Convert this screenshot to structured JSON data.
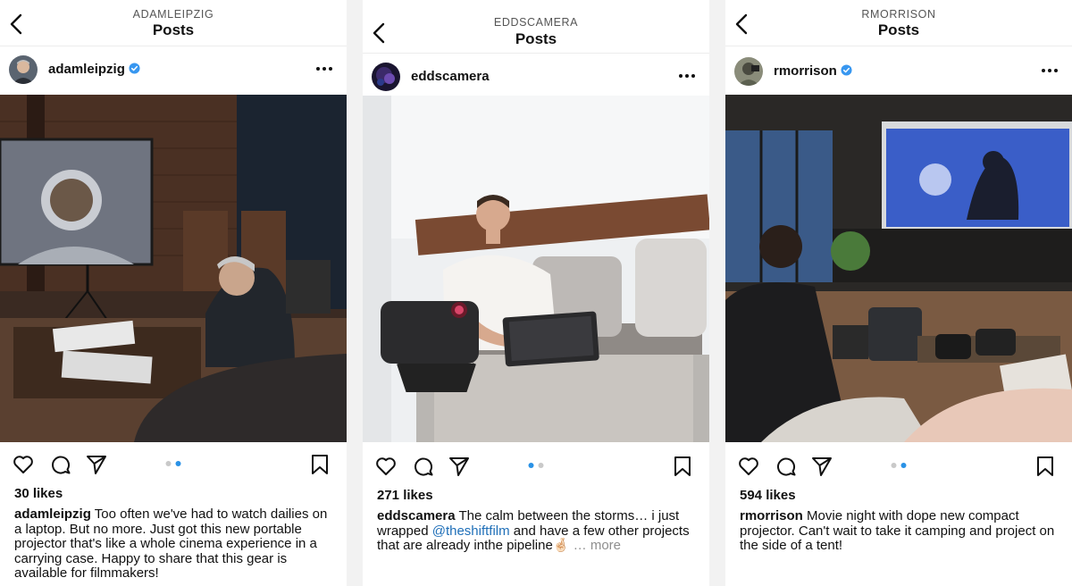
{
  "posts": [
    {
      "account_label": "ADAMLEIPZIG",
      "screen_title": "Posts",
      "username": "adamleipzig",
      "verified": true,
      "likes": "30 likes",
      "caption_user": "adamleipzig",
      "caption_text": "Too often we've had to watch dailies on a laptop. But no more. Just got this new portable projector that's like a whole cinema experience in a carrying case. Happy to share that this gear is available for filmmakers!",
      "carousel": {
        "count": 2,
        "active": 2
      },
      "icons": [
        "back-icon",
        "verified-icon",
        "more-options-icon",
        "heart-icon",
        "comment-icon",
        "share-icon",
        "bookmark-icon"
      ]
    },
    {
      "account_label": "EDDSCAMERA",
      "screen_title": "Posts",
      "username": "eddscamera",
      "verified": false,
      "likes": "271 likes",
      "caption_user": "eddscamera",
      "caption_text_1": "The calm between the storms…  i just wrapped ",
      "mention": "@theshiftfilm",
      "caption_text_2": " and have a few other projects that are already inthe pipeline",
      "emoji": "🤞🏻",
      "more_label": "… more",
      "carousel": {
        "count": 2,
        "active": 1
      },
      "icons": [
        "back-icon",
        "more-options-icon",
        "heart-icon",
        "comment-icon",
        "share-icon",
        "bookmark-icon"
      ]
    },
    {
      "account_label": "RMORRISON",
      "screen_title": "Posts",
      "username": "rmorrison",
      "verified": true,
      "likes": "594 likes",
      "caption_user": "rmorrison",
      "caption_text": "Movie night with dope new compact projector.  Can't wait to take it camping and project on the side of a tent!",
      "carousel": {
        "count": 2,
        "active": 2
      },
      "icons": [
        "back-icon",
        "verified-icon",
        "more-options-icon",
        "heart-icon",
        "comment-icon",
        "share-icon",
        "bookmark-icon"
      ]
    }
  ],
  "colors": {
    "verified": "#3897f0",
    "carousel_active": "#2a92e6",
    "carousel_inactive": "#c9c9c9",
    "mention": "#1f6fb8",
    "muted": "#8e8e8e"
  }
}
